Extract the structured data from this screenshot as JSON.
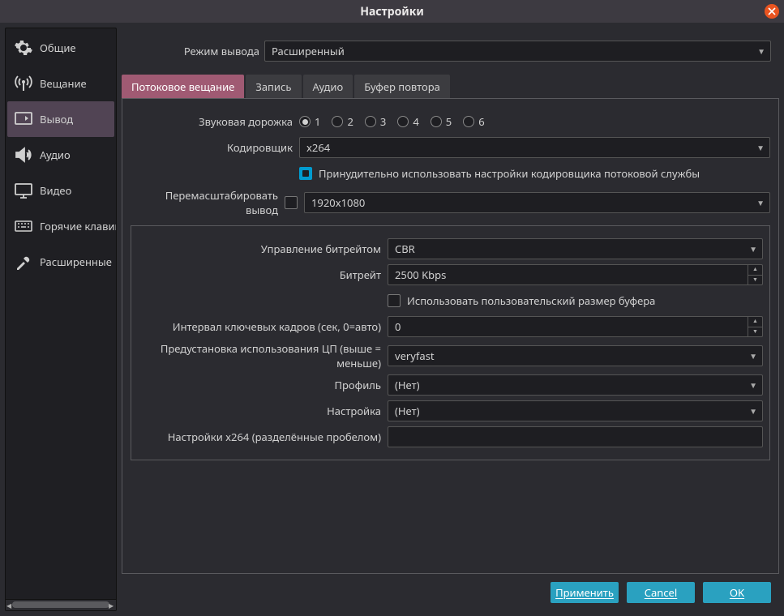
{
  "title": "Настройки",
  "sidebar": {
    "items": [
      {
        "label": "Общие"
      },
      {
        "label": "Вещание"
      },
      {
        "label": "Вывод"
      },
      {
        "label": "Аудио"
      },
      {
        "label": "Видео"
      },
      {
        "label": "Горячие клавиши"
      },
      {
        "label": "Расширенные"
      }
    ],
    "active_index": 2
  },
  "mode": {
    "label": "Режим вывода",
    "value": "Расширенный"
  },
  "tabs": {
    "items": [
      "Потоковое вещание",
      "Запись",
      "Аудио",
      "Буфер повтора"
    ],
    "active_index": 0
  },
  "stream": {
    "audio_track_label": "Звуковая дорожка",
    "audio_tracks": [
      "1",
      "2",
      "3",
      "4",
      "5",
      "6"
    ],
    "audio_track_selected": 0,
    "encoder_label": "Кодировщик",
    "encoder": "x264",
    "enforce_checkbox_checked": true,
    "enforce_label": "Принудительно использовать настройки кодировщика потоковой службы",
    "rescale_label": "Перемасштабировать вывод",
    "rescale_checked": false,
    "rescale_value": "1920x1080"
  },
  "encoder_settings": {
    "rate_control_label": "Управление битрейтом",
    "rate_control": "CBR",
    "bitrate_label": "Битрейт",
    "bitrate": "2500 Kbps",
    "custom_buffer_checked": false,
    "custom_buffer_label": "Использовать пользовательский размер буфера",
    "keyint_label": "Интервал ключевых кадров (сек, 0=авто)",
    "keyint": "0",
    "preset_label": "Предустановка использования ЦП (выше = меньше)",
    "preset": "veryfast",
    "profile_label": "Профиль",
    "profile": "(Нет)",
    "tune_label": "Настройка",
    "tune": "(Нет)",
    "x264opts_label": "Настройки x264 (разделённые пробелом)",
    "x264opts": ""
  },
  "footer": {
    "apply": "Применить",
    "cancel": "Cancel",
    "ok": "OK"
  }
}
